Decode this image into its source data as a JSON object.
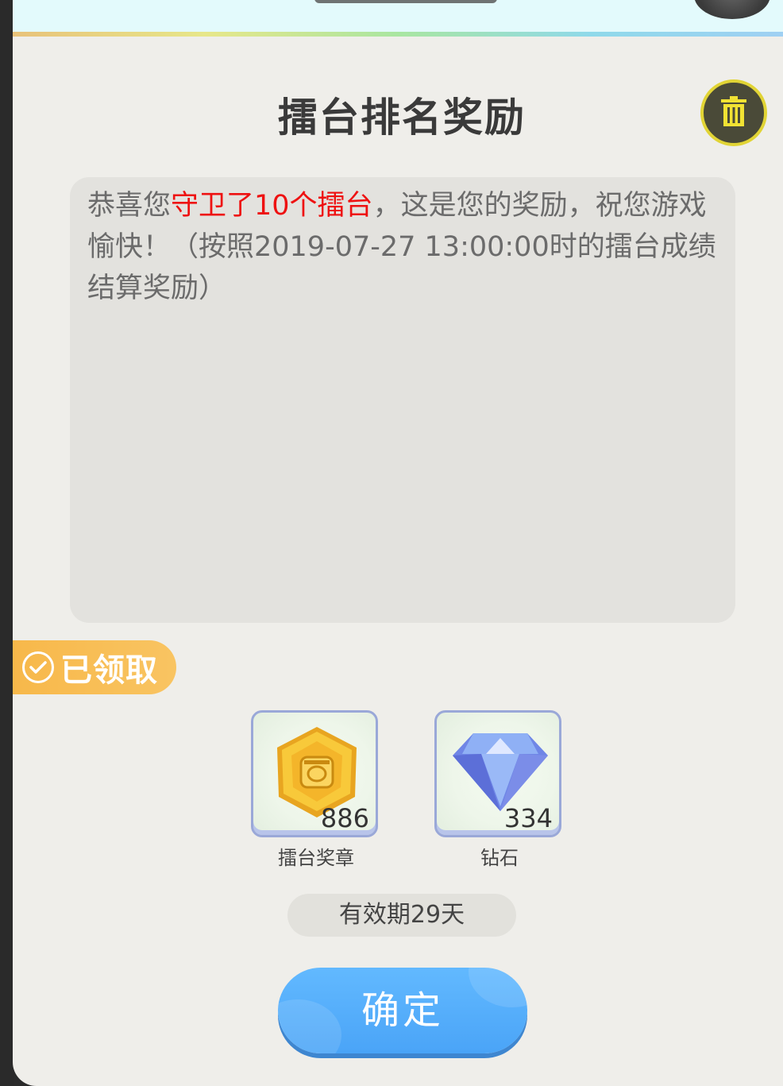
{
  "dialog": {
    "title": "擂台排名奖励"
  },
  "message": {
    "prefix": "恭喜您",
    "highlight": "守卫了10个擂台",
    "suffix": "，这是您的奖励，祝您游戏愉快！（按照2019-07-27 13:00:00时的擂台成绩结算奖励）"
  },
  "status_badge": {
    "label": "已领取"
  },
  "rewards": [
    {
      "name": "擂台奖章",
      "count": "886",
      "icon": "medal-icon"
    },
    {
      "name": "钻石",
      "count": "334",
      "icon": "diamond-icon"
    }
  ],
  "validity": "有效期29天",
  "confirm_button": "确定",
  "colors": {
    "highlight": "#ee1111",
    "badge": "#f7b84a",
    "button": "#52aaf9",
    "trash_ring": "#e1d435"
  }
}
